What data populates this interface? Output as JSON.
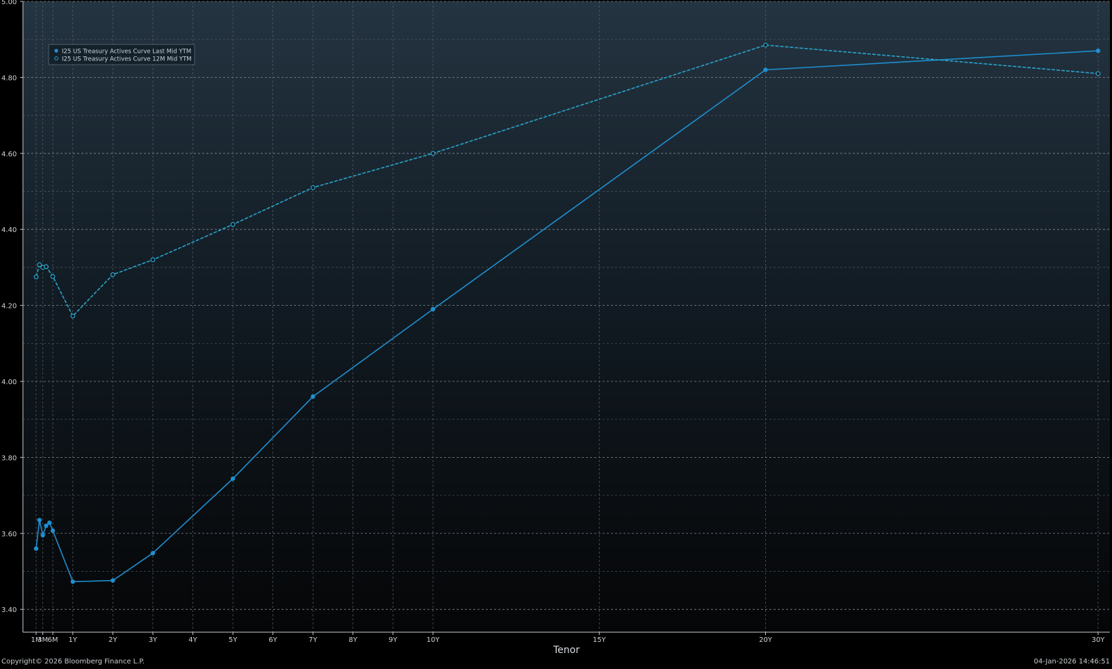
{
  "chart_data": {
    "type": "line",
    "xlabel": "Tenor",
    "ylim": [
      3.34,
      5.0
    ],
    "y_ticks": [
      "3.40",
      "3.60",
      "3.80",
      "4.00",
      "4.20",
      "4.40",
      "4.60",
      "4.80",
      "5.00"
    ],
    "x_ticks": [
      "1M",
      "3M",
      "6M",
      "1Y",
      "2Y",
      "3Y",
      "4Y",
      "5Y",
      "6Y",
      "7Y",
      "8Y",
      "9Y",
      "10Y",
      "15Y",
      "20Y",
      "30Y"
    ],
    "grid": true,
    "legend_position": "top-left",
    "series": [
      {
        "name": "I25 US Treasury Actives Curve Last Mid YTM",
        "style": "solid",
        "marker": "filled",
        "color": "#1f8fd0",
        "points": [
          {
            "tenor": "1M",
            "y": 3.56
          },
          {
            "tenor": "2M",
            "y": 3.635
          },
          {
            "tenor": "3M",
            "y": 3.595
          },
          {
            "tenor": "4M",
            "y": 3.62
          },
          {
            "tenor": "5M",
            "y": 3.628
          },
          {
            "tenor": "6M",
            "y": 3.607
          },
          {
            "tenor": "1Y",
            "y": 3.473
          },
          {
            "tenor": "2Y",
            "y": 3.476
          },
          {
            "tenor": "3Y",
            "y": 3.548
          },
          {
            "tenor": "5Y",
            "y": 3.744
          },
          {
            "tenor": "7Y",
            "y": 3.96
          },
          {
            "tenor": "10Y",
            "y": 4.19
          },
          {
            "tenor": "20Y",
            "y": 4.82
          },
          {
            "tenor": "30Y",
            "y": 4.87
          }
        ]
      },
      {
        "name": "I25 US Treasury Actives Curve 12M Mid YTM",
        "style": "dashed",
        "marker": "hollow",
        "color": "#2aa4cc",
        "points": [
          {
            "tenor": "1M",
            "y": 4.275
          },
          {
            "tenor": "2M",
            "y": 4.307
          },
          {
            "tenor": "3M",
            "y": 4.3
          },
          {
            "tenor": "4M",
            "y": 4.302
          },
          {
            "tenor": "6M",
            "y": 4.276
          },
          {
            "tenor": "1Y",
            "y": 4.172
          },
          {
            "tenor": "2Y",
            "y": 4.281
          },
          {
            "tenor": "3Y",
            "y": 4.32
          },
          {
            "tenor": "5Y",
            "y": 4.413
          },
          {
            "tenor": "7Y",
            "y": 4.51
          },
          {
            "tenor": "10Y",
            "y": 4.6
          },
          {
            "tenor": "20Y",
            "y": 4.885
          },
          {
            "tenor": "30Y",
            "y": 4.81
          }
        ]
      }
    ]
  },
  "footer": {
    "copyright": "Copyright© 2026 Bloomberg Finance L.P.",
    "timestamp": "04-Jan-2026 14:46:51"
  }
}
